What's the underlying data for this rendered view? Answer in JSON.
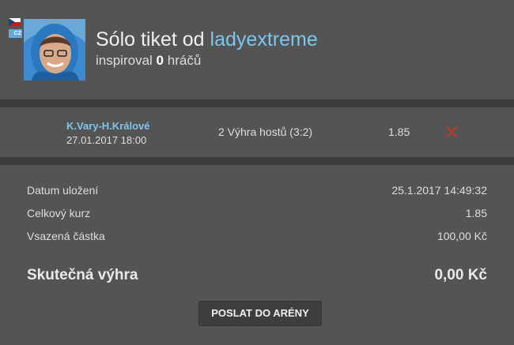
{
  "header": {
    "flag_label": "CZ",
    "title_prefix": "Sólo tiket od",
    "username": "ladyextreme",
    "inspired_prefix": "inspiroval",
    "inspired_count": "0",
    "inspired_suffix": "hráčů"
  },
  "bet": {
    "match": "K.Vary-H.Králové",
    "date": "27.01.2017 18:00",
    "pick": "2 Výhra hostů (3:2)",
    "odds": "1.85"
  },
  "summary": {
    "rows": [
      {
        "label": "Datum uložení",
        "value": "25.1.2017 14:49:32"
      },
      {
        "label": "Celkový kurz",
        "value": "1.85"
      },
      {
        "label": "Vsazená částka",
        "value": "100,00 Kč"
      }
    ],
    "win_label": "Skutečná výhra",
    "win_value": "0,00 Kč"
  },
  "actions": {
    "send_label": "POSLAT DO ARÉNY"
  },
  "colors": {
    "accent": "#7ec6ee",
    "remove": "#c0392b",
    "background": "#545454",
    "divider": "#3c3c3c"
  }
}
